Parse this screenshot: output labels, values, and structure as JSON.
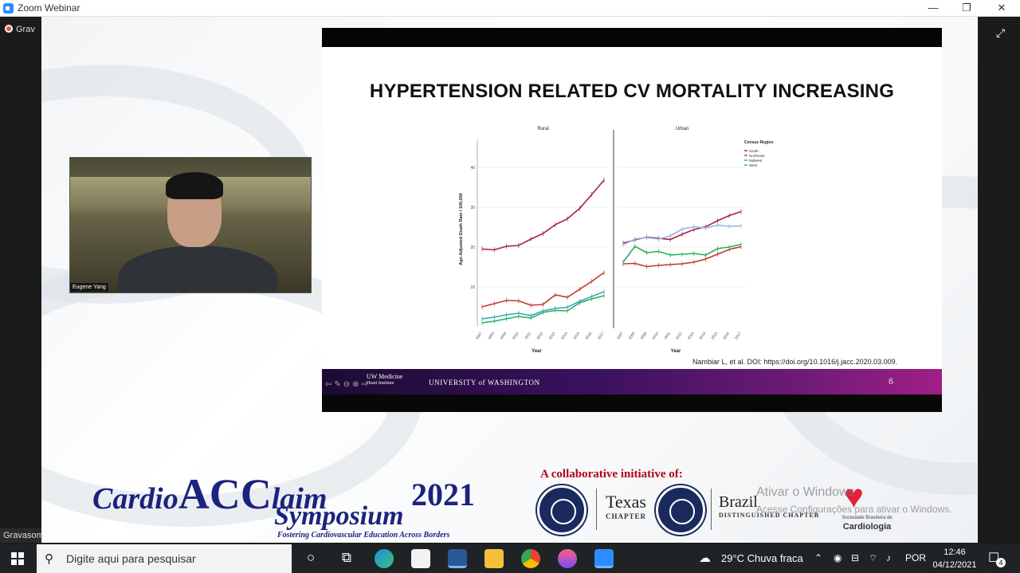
{
  "window": {
    "title": "Zoom Webinar",
    "minimize_glyph": "—",
    "restore_glyph": "❐",
    "close_glyph": "✕"
  },
  "meeting": {
    "recording_label": "Grav",
    "recording_status_label": "Gravasom",
    "fullscreen_icon": "⤢"
  },
  "slide": {
    "title": "HYPERTENSION RELATED CV MORTALITY INCREASING",
    "citation": "Nambiar L, et al.  DOI: https://doi.org/10.1016/j.jacc.2020.03.009.",
    "footer_logo": "UW Medicine",
    "footer_logo_sub": "Heart Institute",
    "footer_university": "UNIVERSITY of WASHINGTON",
    "slide_number": "6"
  },
  "chart_data": {
    "type": "line",
    "panels": [
      {
        "title": "Rural",
        "x": [
          2007,
          2008,
          2009,
          2010,
          2011,
          2012,
          2013,
          2014,
          2015,
          2016,
          2017
        ],
        "series": [
          {
            "name": "South",
            "color": "#a6243a",
            "values": [
              19.5,
              19.3,
              20.2,
              20.4,
              22.0,
              23.4,
              25.6,
              27.1,
              29.7,
              33.2,
              36.8
            ]
          },
          {
            "name": "Northeast",
            "color": "#c0392b",
            "values": [
              5.0,
              5.8,
              6.6,
              6.5,
              5.4,
              5.6,
              8.0,
              7.4,
              9.4,
              11.4,
              13.6
            ]
          },
          {
            "name": "Midwest",
            "color": "#27ae60",
            "values": [
              1.0,
              1.4,
              2.0,
              2.6,
              2.2,
              3.6,
              4.1,
              4.0,
              6.0,
              7.0,
              7.8
            ]
          },
          {
            "name": "West",
            "color": "#3aa6b9",
            "values": [
              2.0,
              2.4,
              3.0,
              3.4,
              2.8,
              4.0,
              4.6,
              4.9,
              6.4,
              7.6,
              8.8
            ]
          }
        ]
      },
      {
        "title": "Urban",
        "x": [
          2007,
          2008,
          2009,
          2010,
          2011,
          2012,
          2013,
          2014,
          2015,
          2016,
          2017
        ],
        "series": [
          {
            "name": "South",
            "color": "#a6243a",
            "values": [
              21.0,
              21.8,
              22.5,
              22.2,
              21.9,
              23.2,
              24.4,
              25.1,
              26.6,
              27.9,
              28.9
            ]
          },
          {
            "name": "Northeast",
            "color": "#c0392b",
            "values": [
              15.8,
              15.9,
              15.1,
              15.4,
              15.6,
              15.8,
              16.2,
              17.0,
              18.2,
              19.4,
              20.1
            ]
          },
          {
            "name": "Midwest",
            "color": "#27ae60",
            "values": [
              16.2,
              20.2,
              18.6,
              18.9,
              18.0,
              18.2,
              18.4,
              18.0,
              19.6,
              20.0,
              20.7
            ]
          },
          {
            "name": "West",
            "color": "#8fb5e0",
            "values": [
              20.6,
              22.0,
              22.4,
              22.0,
              22.8,
              24.5,
              25.1,
              24.8,
              25.5,
              25.2,
              25.3
            ]
          }
        ]
      }
    ],
    "ylabel": "Age-Adjusted Death Rate / 100,000",
    "xlabel": "Year",
    "ylim": [
      0,
      45
    ],
    "yticks": [
      10,
      20,
      30,
      40
    ],
    "legend": {
      "title": "Census Region",
      "placement": "right",
      "entries": [
        "South",
        "Northeast",
        "Midwest",
        "West"
      ]
    },
    "grid": true
  },
  "webcam": {
    "participant_name": "Eugene Yang"
  },
  "symposium": {
    "cardio": "Cardio",
    "acc": "ACC",
    "laim": "laim",
    "symposium": "Symposium",
    "year": "2021",
    "tagline": "Fostering Cardiovascular Education Across Borders",
    "collab": "A collaborative initiative of:",
    "texas": "Texas",
    "texas_sub": "CHAPTER",
    "brazil": "Brazil",
    "brazil_sub": "DISTINGUISHED CHAPTER",
    "sbc_small": "Sociedade Brasileira de",
    "sbc": "Cardiologia"
  },
  "windows_activation": {
    "line1": "Ativar o Windows",
    "line2": "Acesse Configurações para ativar o Windows."
  },
  "taskbar": {
    "search_placeholder": "Digite aqui para pesquisar",
    "weather": "29°C  Chuva fraca",
    "language": "POR",
    "time": "12:46",
    "date": "04/12/2021",
    "notification_count": "4"
  }
}
